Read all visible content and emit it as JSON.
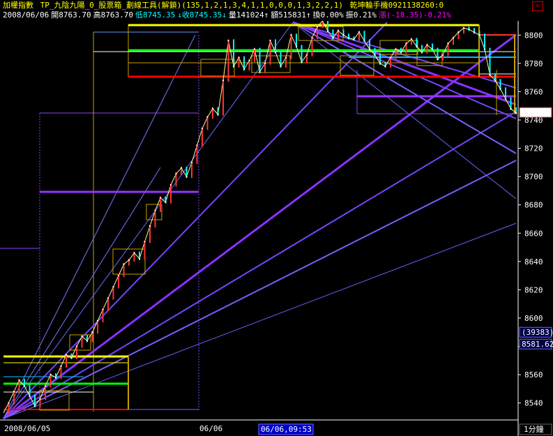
{
  "header": {
    "index_name": "加權指數",
    "indicator": "TP_九陰九陽_0_股票箱_劃線工具(解鎖)(135,1,2,1,3,4,1,1,0,0,0,1,3,2,2,1)",
    "broker": "乾坤輪手機0921138260:0",
    "date": "2008/06/06",
    "open": "開8763.70",
    "high": "高8763.70",
    "low": "低8745.35",
    "close_arrow": "↓",
    "close": "收8745.35",
    "close_arrow2": "↓",
    "volume": "量141024",
    "volume_arrow": "↑",
    "amount": "額515831",
    "amount_arrow": "↑",
    "turnover": "換0.00%",
    "amplitude": "振0.21%",
    "change": "漲(-18.35)-0.21%",
    "close_icon": "close-icon"
  },
  "colors": {
    "yellow": "#ffff00",
    "magenta": "#ff00ff",
    "cyan": "#00ffff",
    "white": "#ffffff",
    "red": "#ff0000",
    "green": "#00ff00",
    "box": "#c8a000",
    "fan": "#8844ff",
    "bull": "#ff3333",
    "bear": "#00ffff"
  },
  "chart_data": {
    "type": "line",
    "ylim": [
      8528,
      8810
    ],
    "y_ticks": [
      8540,
      8560,
      8580,
      8600,
      8620,
      8640,
      8660,
      8680,
      8700,
      8720,
      8740,
      8760,
      8780,
      8800
    ],
    "x_labels": [
      "2008/06/05",
      "06/06"
    ],
    "cursor_label": "06/06,09:53",
    "timeframe": "1分鐘",
    "price_tag": "8745.3",
    "volume_tag": "(39383)",
    "low_tag": "8581.62",
    "series": [
      {
        "values": [
          8533,
          8540,
          8548,
          8556,
          8552,
          8545,
          8538,
          8543,
          8552,
          8560,
          8558,
          8566,
          8574,
          8572,
          8580,
          8587,
          8584,
          8590,
          8598,
          8606,
          8614,
          8622,
          8630,
          8638,
          8641,
          8646,
          8642,
          8654,
          8665,
          8676,
          8685,
          8682,
          8694,
          8702,
          8706,
          8700,
          8710,
          8722,
          8734,
          8742,
          8748,
          8744,
          8768,
          8796,
          8778,
          8784,
          8776,
          8782,
          8790,
          8774,
          8780,
          8796,
          8788,
          8778,
          8784,
          8800,
          8792,
          8781,
          8786,
          8798,
          8806,
          8810,
          8803,
          8798,
          8803,
          8800,
          8798,
          8797,
          8802,
          8796,
          8790,
          8786,
          8780,
          8778,
          8784,
          8790,
          8788,
          8794,
          8797,
          8792,
          8788,
          8793,
          8790,
          8783,
          8786,
          8794,
          8798,
          8802,
          8805,
          8804,
          8802,
          8800,
          8790,
          8772,
          8768,
          8762,
          8755,
          8748,
          8745
        ]
      }
    ]
  }
}
